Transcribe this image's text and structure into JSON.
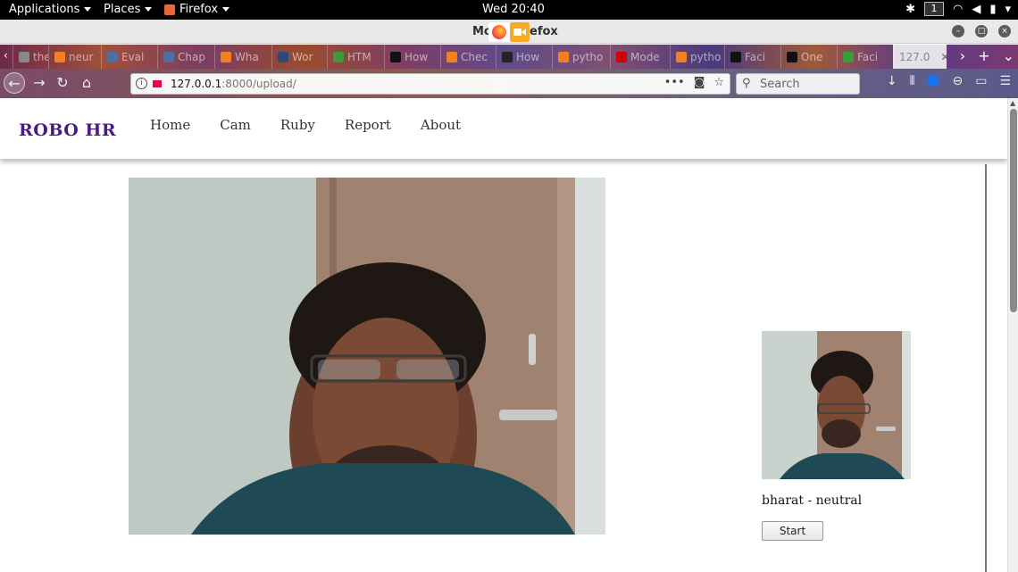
{
  "topbar": {
    "applications": "Applications",
    "places": "Places",
    "app": "Firefox",
    "clock": "Wed 20:40",
    "workspace": "1"
  },
  "window": {
    "title_left": "Mo",
    "title_right": "efox"
  },
  "tabs": [
    {
      "label": "the",
      "icon": "document-icon",
      "color": "#888"
    },
    {
      "label": "neur",
      "icon": "stackoverflow-icon",
      "color": "#f48024"
    },
    {
      "label": "Eval",
      "icon": "puzzle-icon",
      "color": "#4a6fa5"
    },
    {
      "label": "Chap",
      "icon": "book-icon",
      "color": "#4a6fa5"
    },
    {
      "label": "Wha",
      "icon": "stackoverflow-icon",
      "color": "#f48024"
    },
    {
      "label": "Wor",
      "icon": "shield-icon",
      "color": "#2d4a7a"
    },
    {
      "label": "HTM",
      "icon": "w3-icon",
      "color": "#3c9c3c"
    },
    {
      "label": "How",
      "icon": "letter-l-icon",
      "color": "#111"
    },
    {
      "label": "Chec",
      "icon": "stackoverflow-icon",
      "color": "#f48024"
    },
    {
      "label": "How",
      "icon": "github-icon",
      "color": "#222"
    },
    {
      "label": "pytho",
      "icon": "stackoverflow-icon",
      "color": "#f48024"
    },
    {
      "label": "Mode",
      "icon": "letter-k-icon",
      "color": "#d00000"
    },
    {
      "label": "pytho",
      "icon": "stackoverflow-icon",
      "color": "#f48024"
    },
    {
      "label": "Faci",
      "icon": "medium-icon",
      "color": "#111"
    },
    {
      "label": "One",
      "icon": "square-icon",
      "color": "#111"
    },
    {
      "label": "Faci",
      "icon": "android-icon",
      "color": "#3c9c3c"
    },
    {
      "label": "127.0",
      "icon": "",
      "color": ""
    }
  ],
  "urlbar": {
    "host": "127.0.0.1",
    "path": ":8000/upload/",
    "search_placeholder": "Search"
  },
  "site": {
    "brand": "ROBO HR",
    "nav": [
      "Home",
      "Cam",
      "Ruby",
      "Report",
      "About"
    ],
    "result_text": "bharat - neutral",
    "start_button": "Start"
  }
}
